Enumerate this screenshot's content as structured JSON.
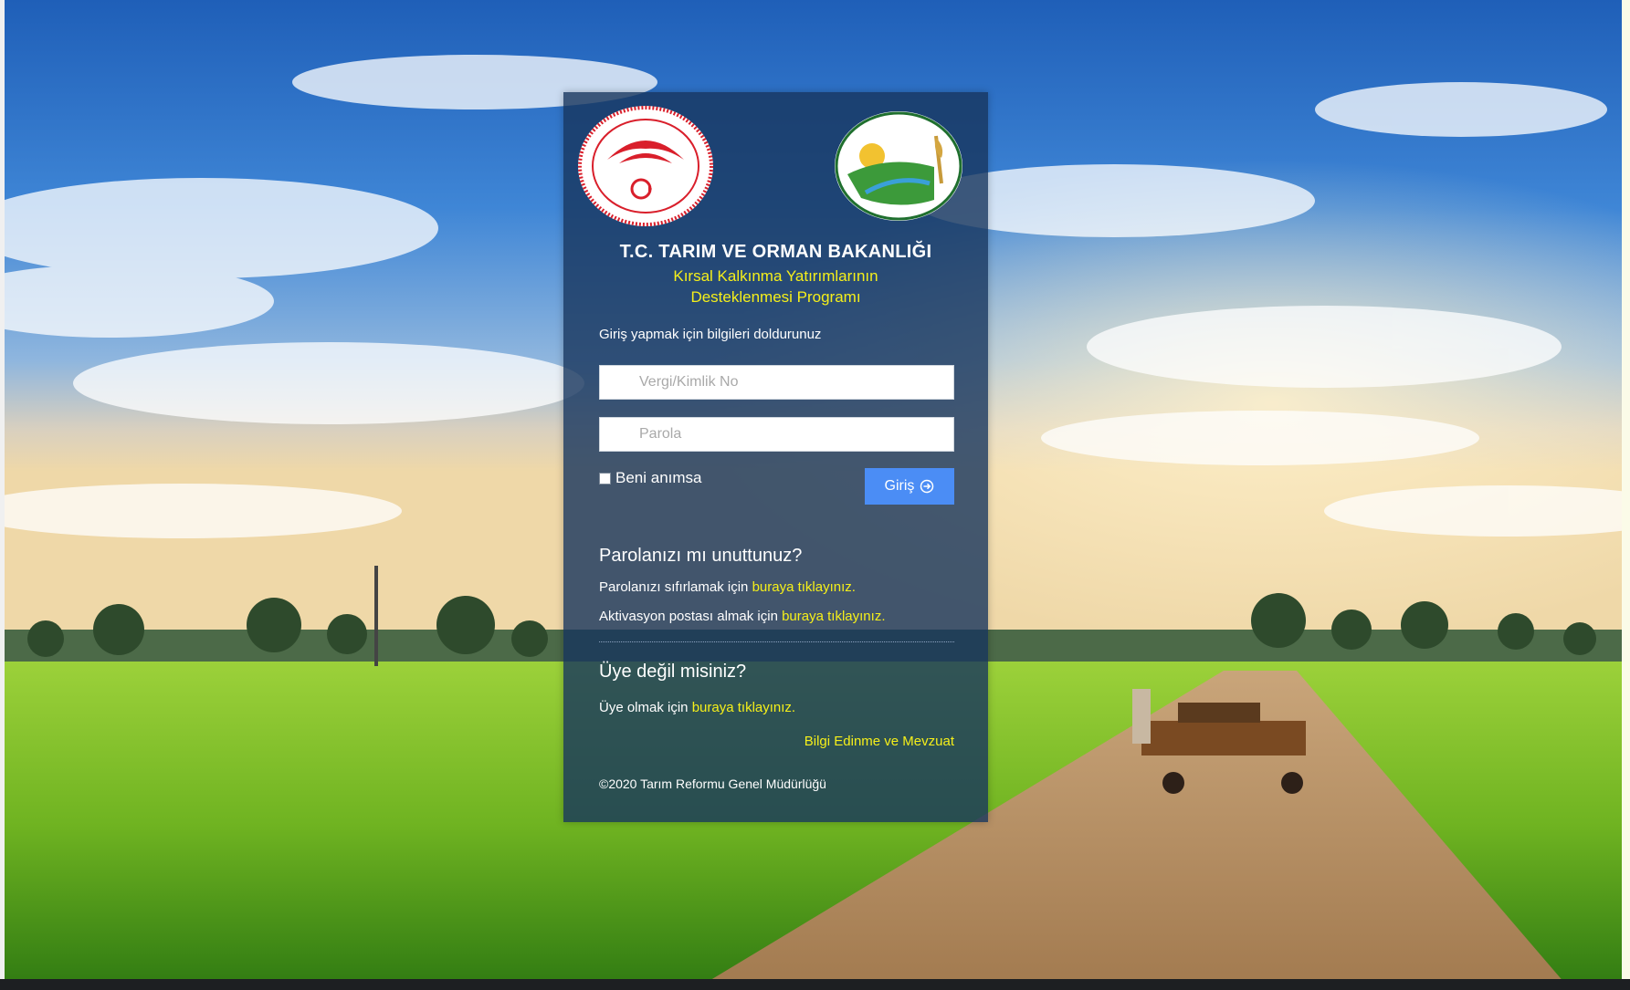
{
  "header": {
    "ministry_title": "T.C. TARIM VE ORMAN BAKANLIĞI",
    "program_title_line1": "Kırsal Kalkınma Yatırımlarının",
    "program_title_line2": "Desteklenmesi Programı"
  },
  "logos": {
    "left": "ministry-emblem-icon",
    "right": "tarim-reformu-logo-icon"
  },
  "login": {
    "hint": "Giriş yapmak için bilgileri doldurunuz",
    "tax_id_placeholder": "Vergi/Kimlik No",
    "tax_id_value": "",
    "password_placeholder": "Parola",
    "password_value": "",
    "remember_label": "Beni anımsa",
    "remember_checked": false,
    "submit_label": "Giriş",
    "submit_icon": "arrow-circle-right-icon"
  },
  "forgot": {
    "heading": "Parolanızı mı unuttunuz?",
    "reset_text": "Parolanızı sıfırlamak için",
    "reset_link": "buraya tıklayınız.",
    "activation_text": "Aktivasyon postası almak için",
    "activation_link": "buraya tıklayınız."
  },
  "register": {
    "heading": "Üye değil misiniz?",
    "text": "Üye olmak için",
    "link": "buraya tıklayınız."
  },
  "footer": {
    "info_link": "Bilgi Edinme ve Mevzuat",
    "copyright": "©2020 Tarım Reformu Genel Müdürlüğü"
  },
  "colors": {
    "accent_yellow": "#f5ef1a",
    "button_blue": "#4b8df5",
    "panel_navy": "#16345c"
  }
}
